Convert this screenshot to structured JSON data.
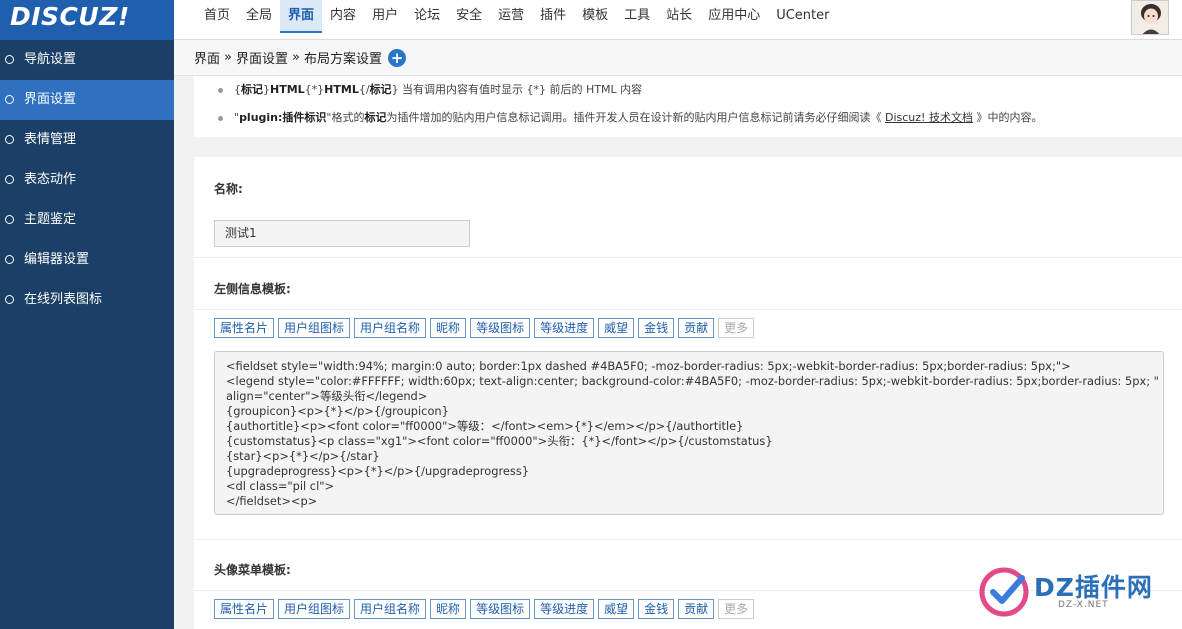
{
  "app": {
    "logo": "DISCUZ!"
  },
  "topnav": [
    {
      "label": "首页"
    },
    {
      "label": "全局"
    },
    {
      "label": "界面",
      "active": true
    },
    {
      "label": "内容"
    },
    {
      "label": "用户"
    },
    {
      "label": "论坛"
    },
    {
      "label": "安全"
    },
    {
      "label": "运营"
    },
    {
      "label": "插件"
    },
    {
      "label": "模板"
    },
    {
      "label": "工具"
    },
    {
      "label": "站长"
    },
    {
      "label": "应用中心"
    },
    {
      "label": "UCenter"
    }
  ],
  "sidebar": {
    "items": [
      {
        "label": "导航设置"
      },
      {
        "label": "界面设置",
        "active": true
      },
      {
        "label": "表情管理"
      },
      {
        "label": "表态动作"
      },
      {
        "label": "主题鉴定"
      },
      {
        "label": "编辑器设置"
      },
      {
        "label": "在线列表图标"
      }
    ]
  },
  "breadcrumb": {
    "items": [
      "界面",
      "界面设置",
      "布局方案设置"
    ],
    "separator": "»",
    "add_icon": "+"
  },
  "tips": {
    "t1_a": "{",
    "t1_b": "标记",
    "t1_c": "}",
    "t1_d": "HTML",
    "t1_e": "{*}",
    "t1_f": "HTML",
    "t1_g": "{/",
    "t1_h": "标记",
    "t1_i": "}",
    "t1_rest": " 当有调用内容有值时显示 {*} 前后的 HTML 内容",
    "t2_a": "\"",
    "t2_b": "plugin:插件标识",
    "t2_c": "\"格式的",
    "t2_d": "标记",
    "t2_e": "为插件增加的贴内用户信息标记调用。插件开发人员在设计新的贴内用户信息标记前请务必仔细阅读《 ",
    "t2_link": "Discuz! 技术文档",
    "t2_f": " 》中的内容。"
  },
  "form": {
    "name_label": "名称:",
    "name_value": "测试1",
    "left_label": "左侧信息模板:",
    "avatar_menu_label": "头像菜单模板:",
    "tag_buttons": [
      "属性名片",
      "用户组图标",
      "用户组名称",
      "昵称",
      "等级图标",
      "等级进度",
      "威望",
      "金钱",
      "贡献"
    ],
    "more_label": "更多",
    "template_text": "<fieldset style=\"width:94%; margin:0 auto; border:1px dashed #4BA5F0; -moz-border-radius: 5px;-webkit-border-radius: 5px;border-radius: 5px;\">\n<legend style=\"color:#FFFFFF; width:60px; text-align:center; background-color:#4BA5F0; -moz-border-radius: 5px;-webkit-border-radius: 5px;border-radius: 5px; \"\nalign=\"center\">等级头衔</legend>\n{groupicon}<p>{*}</p>{/groupicon}\n{authortitle}<p><font color=\"ff0000\">等级：</font><em>{*}</em></p>{/authortitle}\n{customstatus}<p class=\"xg1\"><font color=\"ff0000\">头衔：{*}</font></p>{/customstatus}\n{star}<p>{*}</p>{/star}\n{upgradeprogress}<p>{*}</p>{/upgradeprogress}\n<dl class=\"pil cl\">\n</fieldset><p>"
  },
  "watermark": {
    "text": "DZ插件网",
    "sub": "DZ-X.NET"
  },
  "colors": {
    "brand": "#1f5fae",
    "sidebar": "#1b3f66",
    "sidebar_active": "#2f71bf"
  }
}
